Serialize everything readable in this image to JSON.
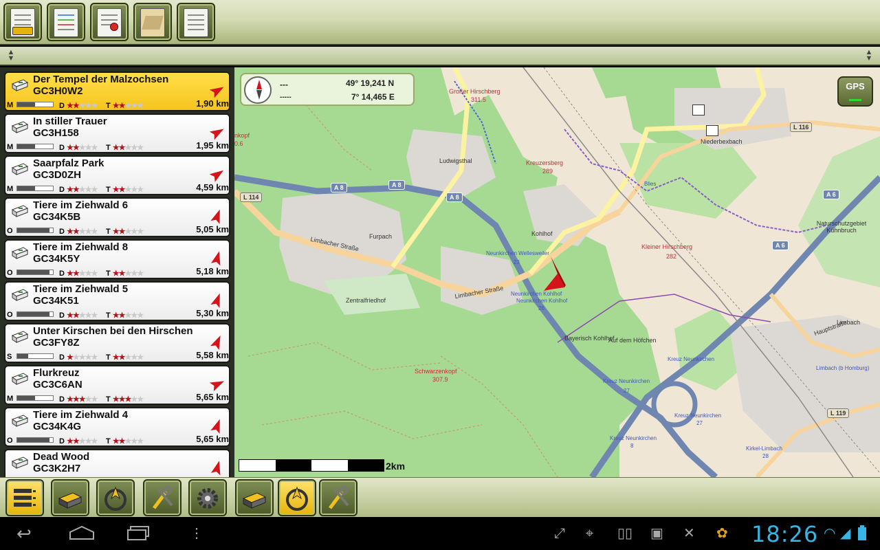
{
  "top_toolbar": {
    "buttons": [
      {
        "name": "cache-list-icon"
      },
      {
        "name": "cache-details-icon"
      },
      {
        "name": "waypoints-icon"
      },
      {
        "name": "map-icon"
      },
      {
        "name": "notes-icon"
      }
    ]
  },
  "caches": [
    {
      "name": "Der Tempel der Malzochsen",
      "code": "GC3H0W2",
      "distance": "1,90 km",
      "size": "M",
      "size_fill": 0.5,
      "difficulty": 1.5,
      "terrain": 1.5,
      "bearing": 60,
      "selected": true
    },
    {
      "name": "In stiller Trauer",
      "code": "GC3H158",
      "distance": "1,95 km",
      "size": "M",
      "size_fill": 0.5,
      "difficulty": 1.5,
      "terrain": 2,
      "bearing": 60,
      "selected": false
    },
    {
      "name": "Saarpfalz Park",
      "code": "GC3D0ZH",
      "distance": "4,59 km",
      "size": "M",
      "size_fill": 0.5,
      "difficulty": 1.5,
      "terrain": 1.5,
      "bearing": 55,
      "selected": false
    },
    {
      "name": "Tiere im Ziehwald 6",
      "code": "GC34K5B",
      "distance": "5,05 km",
      "size": "O",
      "size_fill": 0.9,
      "difficulty": 2,
      "terrain": 2,
      "bearing": 20,
      "selected": false
    },
    {
      "name": "Tiere im Ziehwald 8",
      "code": "GC34K5Y",
      "distance": "5,18 km",
      "size": "O",
      "size_fill": 0.9,
      "difficulty": 2,
      "terrain": 1.5,
      "bearing": 15,
      "selected": false
    },
    {
      "name": "Tiere im Ziehwald 5",
      "code": "GC34K51",
      "distance": "5,30 km",
      "size": "O",
      "size_fill": 0.9,
      "difficulty": 1.5,
      "terrain": 1.5,
      "bearing": 20,
      "selected": false
    },
    {
      "name": "Unter Kirschen bei den Hirschen",
      "code": "GC3FY8Z",
      "distance": "5,58 km",
      "size": "S",
      "size_fill": 0.3,
      "difficulty": 1,
      "terrain": 1.5,
      "bearing": 25,
      "selected": false
    },
    {
      "name": "Flurkreuz",
      "code": "GC3C6AN",
      "distance": "5,65 km",
      "size": "M",
      "size_fill": 0.5,
      "difficulty": 3,
      "terrain": 2.5,
      "bearing": 65,
      "selected": false
    },
    {
      "name": "Tiere im Ziehwald 4",
      "code": "GC34K4G",
      "distance": "5,65 km",
      "size": "O",
      "size_fill": 0.9,
      "difficulty": 2,
      "terrain": 2,
      "bearing": 20,
      "selected": false
    },
    {
      "name": "Dead Wood",
      "code": "GC3K2H7",
      "distance": "",
      "size": "",
      "size_fill": 0,
      "difficulty": 0,
      "terrain": 0,
      "bearing": 15,
      "selected": false
    }
  ],
  "rating_labels": {
    "difficulty": "D",
    "terrain": "T"
  },
  "map": {
    "coords": {
      "lat": "49°  19,241 N",
      "lon": "7°  14,465 E",
      "dist_dashes": "---",
      "speed_dashes": "-----"
    },
    "gps_label": "GPS",
    "scale_label": "2km",
    "labels": [
      {
        "text": "Großer Hirschberg",
        "kind": "red"
      },
      {
        "text": "311.5",
        "kind": "red"
      },
      {
        "text": "Ludwigsthal",
        "kind": "plain"
      },
      {
        "text": "Kreuzersberg",
        "kind": "red"
      },
      {
        "text": "289",
        "kind": "red"
      },
      {
        "text": "Niederbexbach",
        "kind": "plain"
      },
      {
        "text": "Furpach",
        "kind": "plain"
      },
      {
        "text": "Kohlhof",
        "kind": "plain"
      },
      {
        "text": "Limbacher Straße",
        "kind": "plain"
      },
      {
        "text": "Limbacher Straße",
        "kind": "plain"
      },
      {
        "text": "Zentralfriedhof",
        "kind": "plain"
      },
      {
        "text": "Neunkirchen Wellesweiler",
        "kind": "blue"
      },
      {
        "text": "23",
        "kind": "blue"
      },
      {
        "text": "Neunkirchen Kohlhof",
        "kind": "blue"
      },
      {
        "text": "Neunkirchen Kohlhof",
        "kind": "blue"
      },
      {
        "text": "26",
        "kind": "blue"
      },
      {
        "text": "Kleiner Hirschberg",
        "kind": "red"
      },
      {
        "text": "282",
        "kind": "red"
      },
      {
        "text": "Naturschutzgebiet Kühnbruch",
        "kind": "plain"
      },
      {
        "text": "Bayerisch Kohlhof",
        "kind": "plain"
      },
      {
        "text": "Auf dem Höfchen",
        "kind": "plain"
      },
      {
        "text": "Kreuz Neunkirchen",
        "kind": "blue"
      },
      {
        "text": "Kreuz Neunkirchen",
        "kind": "blue"
      },
      {
        "text": "27",
        "kind": "blue"
      },
      {
        "text": "Kreuz Neunkirchen",
        "kind": "blue"
      },
      {
        "text": "27",
        "kind": "blue"
      },
      {
        "text": "Kreuz Neunkirchen",
        "kind": "blue"
      },
      {
        "text": "8",
        "kind": "blue"
      },
      {
        "text": "Schwarzenkopf",
        "kind": "red"
      },
      {
        "text": "307.9",
        "kind": "red"
      },
      {
        "text": "Limbach",
        "kind": "plain"
      },
      {
        "text": "Hauptstraße",
        "kind": "plain"
      },
      {
        "text": "Limbach (b Homburg)",
        "kind": "blue"
      },
      {
        "text": "Kirkel-Limbach",
        "kind": "blue"
      },
      {
        "text": "28",
        "kind": "blue"
      },
      {
        "text": "Blies",
        "kind": "blue"
      },
      {
        "text": "nkopf",
        "kind": "red"
      },
      {
        "text": "0.6",
        "kind": "red"
      }
    ],
    "road_badges": [
      "A 8",
      "A 8",
      "A 8",
      "L 114",
      "L 116",
      "A 6",
      "A 6",
      "L 119"
    ]
  },
  "bottom_toolbar": {
    "buttons": [
      {
        "name": "list-view-icon",
        "active": true
      },
      {
        "name": "cache-icon",
        "active": false
      },
      {
        "name": "compass-icon",
        "active": false
      },
      {
        "name": "tools-icon",
        "active": false
      },
      {
        "name": "settings-gear-icon",
        "active": false
      },
      {
        "name": "cache-icon",
        "active": false
      },
      {
        "name": "compass-icon",
        "active": true
      },
      {
        "name": "tools-icon",
        "active": false
      }
    ]
  },
  "system_bar": {
    "time": "18:26",
    "accent": "#37b5e5"
  },
  "colors": {
    "forest": "#9fd58f",
    "urban": "#dcd8d4",
    "motorway": "#6f87b0",
    "primary_road": "#fbf3a1",
    "selected_cache": "#ffd42a"
  }
}
